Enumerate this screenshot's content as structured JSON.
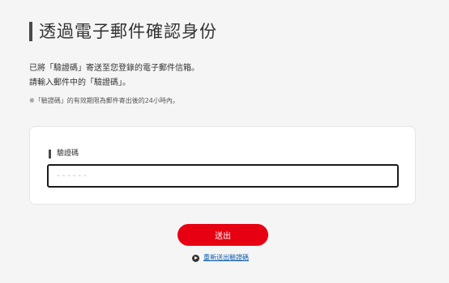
{
  "header": {
    "title": "透過電子郵件確認身份"
  },
  "description": {
    "line1": "已將「驗證碼」寄送至您登錄的電子郵件信箱。",
    "line2": "請輸入郵件中的「驗證碼」。"
  },
  "note": "※「驗證碼」的有效期限為郵件寄出後的24小時內。",
  "form": {
    "label": "驗證碼",
    "placeholder": "------",
    "value": ""
  },
  "actions": {
    "submit_label": "送出",
    "resend_label": "重新送出驗證碼"
  },
  "colors": {
    "accent": "#e60012",
    "link": "#0b5aa8",
    "background": "#f5f5f5"
  },
  "icons": {
    "resend": "circle-arrow-right-icon"
  }
}
